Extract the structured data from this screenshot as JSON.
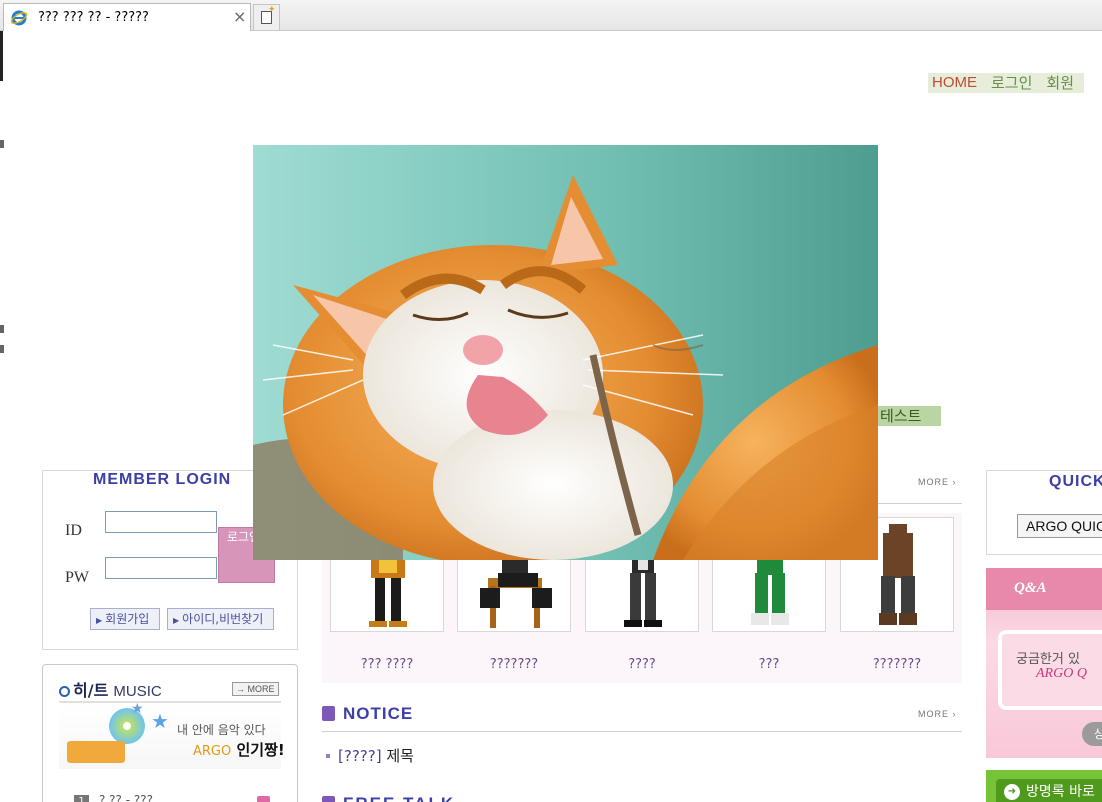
{
  "browser": {
    "tab_title": "??? ??? ?? - ?????",
    "close_glyph": "×"
  },
  "nav": {
    "home": "HOME",
    "login": "로그인",
    "join": "회원"
  },
  "side_tab": "테스트",
  "member_login": {
    "title": "MEMBER LOGIN",
    "id_label": "ID",
    "pw_label": "PW",
    "id_value": "",
    "pw_value": "",
    "login_button": "로그인",
    "join_button": "회원가입",
    "find_button": "아이디,비번찾기"
  },
  "music": {
    "title_strong": "히/트",
    "title_light": "MUSIC",
    "more": "MORE",
    "banner_line1": "내 안에 음악 있다",
    "banner_argo": "ARGO",
    "banner_line2": "인기짱!",
    "rows": [
      {
        "rank": "1",
        "text": "? ??  - ???"
      }
    ]
  },
  "gallery": {
    "more": "MORE",
    "items": [
      {
        "name": "??? ????"
      },
      {
        "name": "???????"
      },
      {
        "name": "????"
      },
      {
        "name": "???"
      },
      {
        "name": "???????"
      }
    ]
  },
  "notice": {
    "title": "NOTICE",
    "more": "MORE",
    "items": [
      {
        "tag": "[????]",
        "title": "제목"
      }
    ]
  },
  "freetalk": {
    "title": "FREE TALK"
  },
  "quick": {
    "title": "QUICK",
    "select_value": "ARGO QUICK"
  },
  "qa": {
    "label": "Q&A",
    "text1": "궁금한거 있",
    "text2": "ARGO Q",
    "button": "상"
  },
  "guestbook": {
    "button": "방명록 바로"
  },
  "colors": {
    "accent_blue": "#3b3fa6",
    "login_pink": "#d795b9",
    "nav_home": "#c24a34",
    "nav_green": "#6a8b4a"
  }
}
